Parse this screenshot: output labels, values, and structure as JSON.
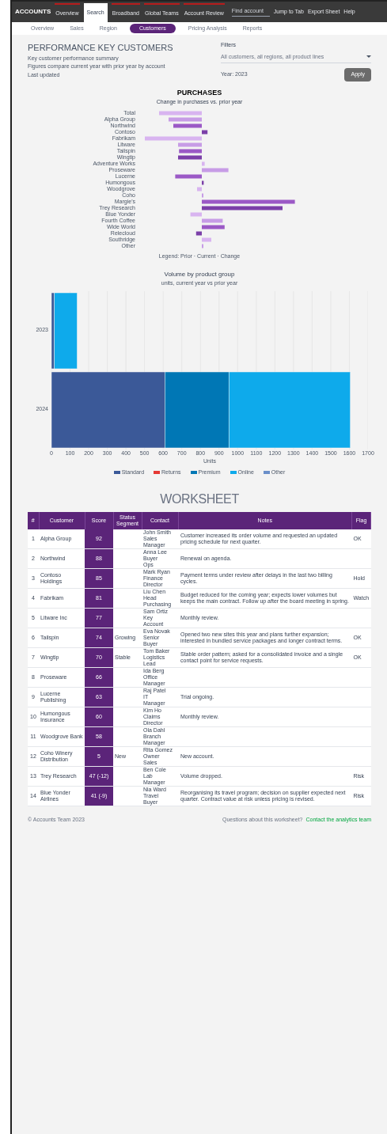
{
  "nav": {
    "logo": "ACCOUNTS",
    "items": [
      {
        "label": "Overview",
        "selected": false
      },
      {
        "label": "Search",
        "selected": true
      },
      {
        "label": "Broadband",
        "selected": false
      },
      {
        "label": "Global Teams",
        "selected": false
      },
      {
        "label": "Account Review",
        "selected": false
      }
    ],
    "search": {
      "placeholder": "Find account"
    },
    "links": [
      "Jump to Tab",
      "Export Sheet",
      "Help"
    ]
  },
  "subnav": [
    {
      "label": "Overview",
      "selected": false
    },
    {
      "label": "Sales",
      "selected": false
    },
    {
      "label": "Region",
      "selected": false
    },
    {
      "label": "Customers",
      "selected": true
    },
    {
      "label": "Pricing Analysis",
      "selected": false
    },
    {
      "label": "Reports",
      "selected": false
    }
  ],
  "header": {
    "title": "PERFORMANCE KEY CUSTOMERS",
    "lines": [
      "Key customer performance summary",
      "Figures compare current year with prior year by account",
      "Last updated"
    ]
  },
  "filter": {
    "label": "Filters",
    "value": "All customers, all regions, all product lines",
    "date": "Year: 2023",
    "button": "Apply"
  },
  "purchases": {
    "title": "PURCHASES",
    "subtitle": "Change in purchases vs. prior year",
    "labels": [
      "Total",
      "Alpha Group",
      "Northwind",
      "Contoso",
      "Fabrikam",
      "Litware",
      "Tailspin",
      "Wingtip",
      "Adventure Works",
      "Proseware",
      "Lucerne",
      "Humongous",
      "Woodgrove",
      "Coho",
      "Margie's",
      "Trey Research",
      "Blue Yonder",
      "Fourth Coffee",
      "Wide World",
      "Relecloud",
      "Southridge",
      "Other"
    ],
    "legend": "Legend: Prior · Current · Change"
  },
  "volume": {
    "title": "Volume by product group",
    "subtitle": "units, current year vs prior year",
    "chart_data": {
      "type": "bar",
      "orientation": "horizontal",
      "stacked": true,
      "xlabel": "Units",
      "categories": [
        "2023",
        "2024"
      ],
      "grid": true,
      "xlim": [
        0,
        1700
      ],
      "xticks": [
        0,
        100,
        200,
        300,
        400,
        500,
        600,
        700,
        800,
        900,
        1000,
        1100,
        1200,
        1300,
        1400,
        1500,
        1600,
        1700
      ],
      "series": [
        {
          "name": "Standard",
          "color": "#3b5998",
          "values": [
            16,
            609
          ]
        },
        {
          "name": "Returns",
          "color": "#e53935",
          "values": [
            0,
            0
          ]
        },
        {
          "name": "Premium",
          "color": "#0077b5",
          "values": [
            0,
            344
          ]
        },
        {
          "name": "Online",
          "color": "#0eaaeb",
          "values": [
            122,
            652
          ]
        },
        {
          "name": "Other",
          "color": "#6a8fc9",
          "values": [
            0,
            0
          ]
        }
      ]
    }
  },
  "worksheet": {
    "title": "WORKSHEET",
    "columns": [
      "#",
      "Customer",
      "Score",
      "Status Segment",
      "Contact",
      "Notes",
      "Flag"
    ],
    "rows": [
      {
        "no": "1",
        "customer": "Alpha Group",
        "score": "92",
        "segment": "",
        "contact": [
          "John Smith",
          "Sales",
          "Manager"
        ],
        "notes": "Customer increased its order volume and requested an updated pricing schedule for next quarter.",
        "flag": "OK"
      },
      {
        "no": "2",
        "customer": "Northwind",
        "score": "88",
        "segment": "",
        "contact": [
          "Anna Lee",
          "Buyer",
          "Ops"
        ],
        "notes": "Renewal on agenda.",
        "flag": ""
      },
      {
        "no": "3",
        "customer": "Contoso Holdings",
        "score": "85",
        "segment": "",
        "contact": [
          "Mark Ryan",
          "Finance",
          "Director"
        ],
        "notes": "Payment terms under review after delays in the last two billing cycles.",
        "flag": "Hold"
      },
      {
        "no": "4",
        "customer": "Fabrikam",
        "score": "81",
        "segment": "",
        "contact": [
          "Liu Chen",
          "Head",
          "Purchasing"
        ],
        "notes": "Budget reduced for the coming year; expects lower volumes but keeps the main contract. Follow up after the board meeting in spring.",
        "flag": "Watch"
      },
      {
        "no": "5",
        "customer": "Litware Inc",
        "score": "77",
        "segment": "",
        "contact": [
          "Sam Ortiz",
          "Key",
          "Account"
        ],
        "notes": "Monthly review.",
        "flag": ""
      },
      {
        "no": "6",
        "customer": "Tailspin",
        "score": "74",
        "segment": "Growing",
        "contact": [
          "Eva Novak",
          "Senior",
          "Buyer"
        ],
        "notes": "Opened two new sites this year and plans further expansion; interested in bundled service packages and longer contract terms.",
        "flag": "OK"
      },
      {
        "no": "7",
        "customer": "Wingtip",
        "score": "70",
        "segment": "Stable",
        "contact": [
          "Tom Baker",
          "Logistics",
          "Lead"
        ],
        "notes": "Stable order pattern; asked for a consolidated invoice and a single contact point for service requests.",
        "flag": "OK"
      },
      {
        "no": "8",
        "customer": "Proseware",
        "score": "66",
        "segment": "",
        "contact": [
          "Ida Berg",
          "Office",
          "Manager"
        ],
        "notes": "",
        "flag": ""
      },
      {
        "no": "9",
        "customer": "Lucerne Publishing",
        "score": "63",
        "segment": "",
        "contact": [
          "Raj Patel",
          "IT",
          "Manager"
        ],
        "notes": "Trial ongoing.",
        "flag": ""
      },
      {
        "no": "10",
        "customer": "Humongous Insurance",
        "score": "60",
        "segment": "",
        "contact": [
          "Kim Ho",
          "Claims",
          "Director"
        ],
        "notes": "Monthly review.",
        "flag": ""
      },
      {
        "no": "11",
        "customer": "Woodgrove Bank",
        "score": "58",
        "segment": "",
        "contact": [
          "Ola Dahl",
          "Branch",
          "Manager"
        ],
        "notes": "",
        "flag": ""
      },
      {
        "no": "12",
        "customer": "Coho Winery Distribution",
        "score": "5",
        "segment": "New",
        "contact": [
          "Rita Gomez",
          "Owner",
          "Sales"
        ],
        "notes": "New account.",
        "flag": ""
      },
      {
        "no": "13",
        "customer": "Trey Research",
        "score": "47 (-12)",
        "segment": "",
        "contact": [
          "Ben Cole",
          "Lab",
          "Manager"
        ],
        "notes": "Volume dropped.",
        "flag": "Risk"
      },
      {
        "no": "14",
        "customer": "Blue Yonder Airlines",
        "score": "41 (-9)",
        "segment": "",
        "contact": [
          "Nia Ward",
          "Travel",
          "Buyer"
        ],
        "notes": "Reorganising its travel program; decision on supplier expected next quarter. Contract value at risk unless pricing is revised.",
        "flag": "Risk"
      }
    ]
  },
  "footer": {
    "left": "© Accounts Team 2023",
    "text": "Questions about this worksheet?",
    "link": "Contact the analytics team"
  }
}
